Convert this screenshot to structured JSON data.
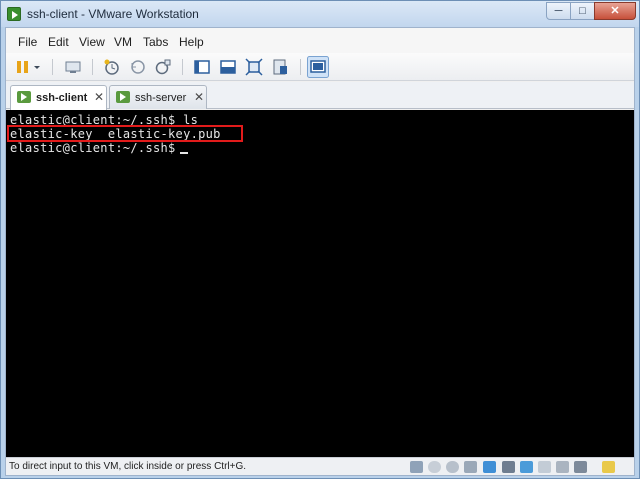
{
  "window": {
    "title": "ssh-client - VMware Workstation"
  },
  "window_controls": {
    "minimize": "─",
    "maximize": "□",
    "close": "✕"
  },
  "menu": {
    "items": [
      {
        "label": "File"
      },
      {
        "label": "Edit"
      },
      {
        "label": "View"
      },
      {
        "label": "VM"
      },
      {
        "label": "Tabs"
      },
      {
        "label": "Help"
      }
    ]
  },
  "toolbar": {
    "icons": [
      "pause-icon",
      "dropdown-arrow-icon",
      "send-ctrl-alt-del-icon",
      "snapshot-icon",
      "revert-snapshot-icon",
      "snapshot-manager-icon",
      "console-view-icon",
      "quick-switch-icon",
      "fullscreen-icon",
      "unity-icon",
      "thumbnail-icon"
    ]
  },
  "tabs": [
    {
      "label": "ssh-client",
      "active": true,
      "close": "✕"
    },
    {
      "label": "ssh-server",
      "active": false,
      "close": "✕"
    }
  ],
  "terminal": {
    "lines": [
      "elastic@client:~/.ssh$ ls",
      "elastic-key  elastic-key.pub",
      "elastic@client:~/.ssh$"
    ]
  },
  "status": {
    "text": "To direct input to this VM, click inside or press Ctrl+G."
  },
  "colors": {
    "highlight": "#e21b1b",
    "console_bg": "#000000"
  }
}
